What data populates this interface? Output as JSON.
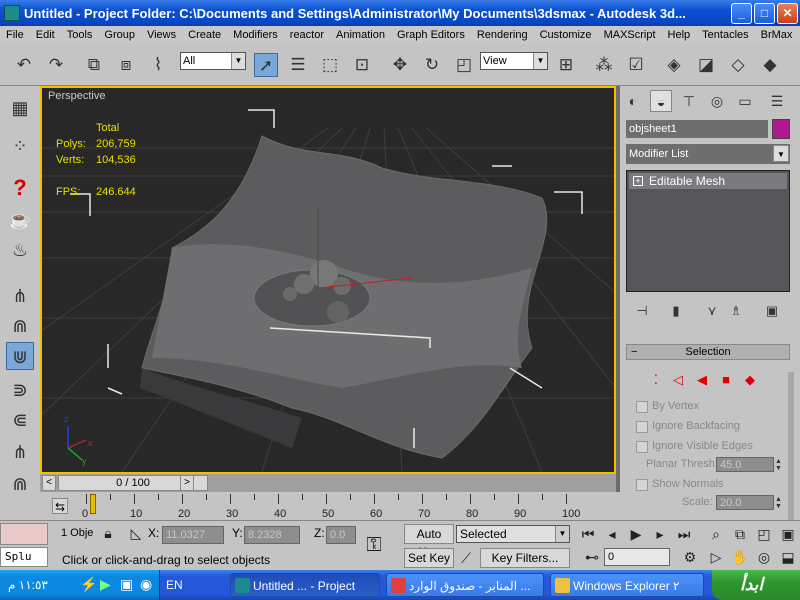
{
  "window": {
    "title": "Untitled   - Project Folder: C:\\Documents and Settings\\Administrator\\My Documents\\3dsmax   - Autodesk 3d...",
    "min": "_",
    "max": "□",
    "close": "✕"
  },
  "menu": [
    "File",
    "Edit",
    "Tools",
    "Group",
    "Views",
    "Create",
    "Modifiers",
    "reactor",
    "Animation",
    "Graph Editors",
    "Rendering",
    "Customize",
    "MAXScript",
    "Help",
    "Tentacles",
    "BrMax"
  ],
  "toolbar": {
    "selection_filter": "All",
    "ref_coord": "View"
  },
  "viewport": {
    "label": "Perspective",
    "stats_header": "Total",
    "polys_label": "Polys:",
    "polys_value": "206,759",
    "verts_label": "Verts:",
    "verts_value": "104,536",
    "fps_label": "FPS:",
    "fps_value": "246.644",
    "axis_x": "x",
    "axis_y": "y",
    "axis_z": "z"
  },
  "cmdpanel": {
    "object_name": "objsheet1",
    "object_color": "#b01890",
    "modifier_list": "Modifier List",
    "stack_item": "Editable Mesh",
    "rollout_title": "Selection",
    "rollout_toggle": "−",
    "checks": [
      "By Vertex",
      "Ignore Backfacing",
      "Ignore Visible Edges"
    ],
    "planar_label": "Planar Thresh:",
    "planar_value": "45.0",
    "show_normals": "Show Normals",
    "scale_label": "Scale:",
    "scale_value": "20.0"
  },
  "timeline": {
    "frame_display": "0 / 100",
    "prev": "<",
    "next": ">",
    "ticks": [
      "0",
      "10",
      "20",
      "30",
      "40",
      "50",
      "60",
      "70",
      "80",
      "90",
      "100"
    ]
  },
  "status": {
    "listener_text": "Splu",
    "selection_count": "1 Obje",
    "x_label": "X:",
    "x_value": "11.0327",
    "y_label": "Y:",
    "y_value": "8.2328",
    "z_label": "Z:",
    "z_value": "0.0",
    "prompt": "Click or click-and-drag to select objects",
    "auto_key": "Auto Key",
    "set_key": "Set Key",
    "key_mode": "Selected",
    "key_filters": "Key Filters...",
    "frame_value": "0"
  },
  "taskbar": {
    "clock": "١١:٥٣ م",
    "lang": "EN",
    "tasks": [
      "Untitled ...   - Project",
      "المنابر - صندوق الوارد ...",
      "Windows Explorer ٢"
    ],
    "start": "ابدأ"
  }
}
